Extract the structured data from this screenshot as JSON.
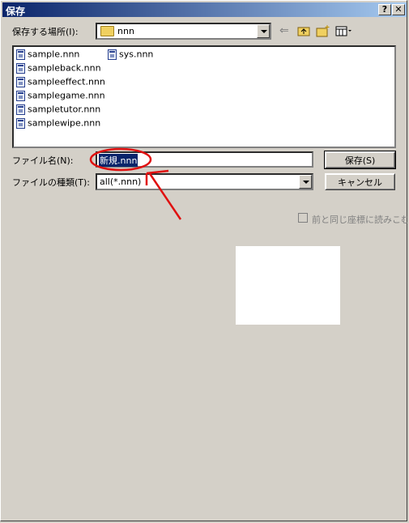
{
  "window": {
    "title": "保存",
    "help_label": "?",
    "close_label": "✕"
  },
  "location": {
    "label": "保存する場所(I):",
    "value": "nnn"
  },
  "toolbar": {
    "back_icon": "back-arrow-icon",
    "up_icon": "up-folder-icon",
    "new_folder_icon": "new-folder-icon",
    "view_icon": "view-menu-icon"
  },
  "files": [
    {
      "name": "sample.nnn"
    },
    {
      "name": "sampleback.nnn"
    },
    {
      "name": "sampleeffect.nnn"
    },
    {
      "name": "samplegame.nnn"
    },
    {
      "name": "sampletutor.nnn"
    },
    {
      "name": "samplewipe.nnn"
    },
    {
      "name": "sys.nnn"
    }
  ],
  "filename": {
    "label": "ファイル名(N):",
    "value": "新規.nnn"
  },
  "filetype": {
    "label": "ファイルの種類(T):",
    "value": "all(*.nnn)"
  },
  "buttons": {
    "save": "保存(S)",
    "cancel": "キャンセル"
  },
  "checkbox": {
    "label": "前と同じ座標に読みこむ",
    "checked": false
  },
  "colors": {
    "annotation": "#e01010",
    "titlebar": "#0a246a"
  }
}
